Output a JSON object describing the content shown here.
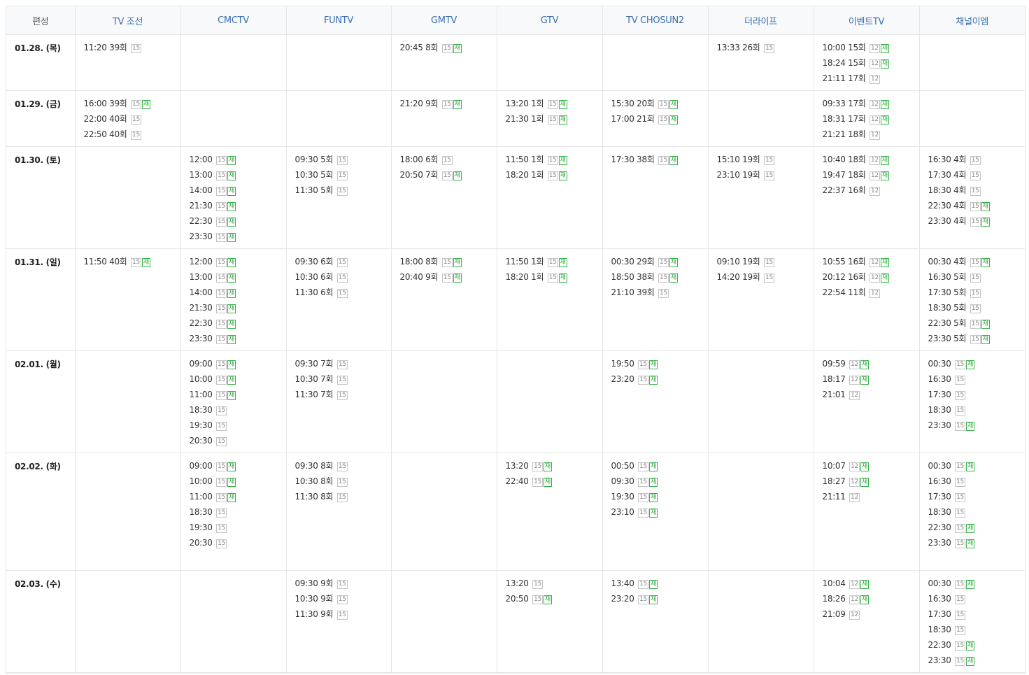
{
  "header": [
    "편성",
    "TV 조선",
    "CMCTV",
    "FUNTV",
    "GMTV",
    "GTV",
    "TV CHOSUN2",
    "더라이프",
    "이벤트TV",
    "채널이엠"
  ],
  "rows": [
    {
      "date": "01.28. (목)",
      "h": 80,
      "cells": [
        [
          {
            "t": "11:20",
            "e": "39회",
            "a": "15"
          }
        ],
        [],
        [],
        [
          {
            "t": "20:45",
            "e": "8회",
            "a": "15",
            "r": "재"
          }
        ],
        [],
        [],
        [
          {
            "t": "13:33",
            "e": "26회",
            "a": "15"
          }
        ],
        [
          {
            "t": "10:00",
            "e": "15회",
            "a": "12",
            "r": "재"
          },
          {
            "t": "18:24",
            "e": "15회",
            "a": "12",
            "r": "재"
          },
          {
            "t": "21:11",
            "e": "17회",
            "a": "12"
          }
        ],
        []
      ]
    },
    {
      "date": "01.29. (금)",
      "h": 80,
      "cells": [
        [
          {
            "t": "16:00",
            "e": "39회",
            "a": "15",
            "r": "재"
          },
          {
            "t": "22:00",
            "e": "40회",
            "a": "15"
          },
          {
            "t": "22:50",
            "e": "40회",
            "a": "15"
          }
        ],
        [],
        [],
        [
          {
            "t": "21:20",
            "e": "9회",
            "a": "15",
            "r": "재"
          }
        ],
        [
          {
            "t": "13:20",
            "e": "1회",
            "a": "15",
            "r": "재"
          },
          {
            "t": "21:30",
            "e": "1회",
            "a": "15",
            "r": "재"
          }
        ],
        [
          {
            "t": "15:30",
            "e": "20회",
            "a": "15",
            "r": "재"
          },
          {
            "t": "17:00",
            "e": "21회",
            "a": "15",
            "r": "재"
          }
        ],
        [],
        [
          {
            "t": "09:33",
            "e": "17회",
            "a": "12",
            "r": "재"
          },
          {
            "t": "18:31",
            "e": "17회",
            "a": "12",
            "r": "재"
          },
          {
            "t": "21:21",
            "e": "18회",
            "a": "12"
          }
        ],
        []
      ]
    },
    {
      "date": "01.30. (토)",
      "h": 146,
      "cells": [
        [],
        [
          {
            "t": "12:00",
            "a": "15",
            "r": "재"
          },
          {
            "t": "13:00",
            "a": "15",
            "r": "재"
          },
          {
            "t": "14:00",
            "a": "15",
            "r": "재"
          },
          {
            "t": "21:30",
            "a": "15",
            "r": "재"
          },
          {
            "t": "22:30",
            "a": "15",
            "r": "재"
          },
          {
            "t": "23:30",
            "a": "15",
            "r": "재"
          }
        ],
        [
          {
            "t": "09:30",
            "e": "5회",
            "a": "15"
          },
          {
            "t": "10:30",
            "e": "5회",
            "a": "15"
          },
          {
            "t": "11:30",
            "e": "5회",
            "a": "15"
          }
        ],
        [
          {
            "t": "18:00",
            "e": "6회",
            "a": "15"
          },
          {
            "t": "20:50",
            "e": "7회",
            "a": "15",
            "r": "재"
          }
        ],
        [
          {
            "t": "11:50",
            "e": "1회",
            "a": "15",
            "r": "재"
          },
          {
            "t": "18:20",
            "e": "1회",
            "a": "15",
            "r": "재"
          }
        ],
        [
          {
            "t": "17:30",
            "e": "38회",
            "a": "15",
            "r": "재"
          }
        ],
        [
          {
            "t": "15:10",
            "e": "19회",
            "a": "15"
          },
          {
            "t": "23:10",
            "e": "19회",
            "a": "15"
          }
        ],
        [
          {
            "t": "10:40",
            "e": "18회",
            "a": "12",
            "r": "재"
          },
          {
            "t": "19:47",
            "e": "18회",
            "a": "12",
            "r": "재"
          },
          {
            "t": "22:37",
            "e": "16회",
            "a": "12"
          }
        ],
        [
          {
            "t": "16:30",
            "e": "4회",
            "a": "15"
          },
          {
            "t": "17:30",
            "e": "4회",
            "a": "15"
          },
          {
            "t": "18:30",
            "e": "4회",
            "a": "15"
          },
          {
            "t": "22:30",
            "e": "4회",
            "a": "15",
            "r": "재"
          },
          {
            "t": "23:30",
            "e": "4회",
            "a": "15",
            "r": "재"
          }
        ]
      ]
    },
    {
      "date": "01.31. (일)",
      "h": 146,
      "cells": [
        [
          {
            "t": "11:50",
            "e": "40회",
            "a": "15",
            "r": "재"
          }
        ],
        [
          {
            "t": "12:00",
            "a": "15",
            "r": "재"
          },
          {
            "t": "13:00",
            "a": "15",
            "r": "재"
          },
          {
            "t": "14:00",
            "a": "15",
            "r": "재"
          },
          {
            "t": "21:30",
            "a": "15",
            "r": "재"
          },
          {
            "t": "22:30",
            "a": "15",
            "r": "재"
          },
          {
            "t": "23:30",
            "a": "15",
            "r": "재"
          }
        ],
        [
          {
            "t": "09:30",
            "e": "6회",
            "a": "15"
          },
          {
            "t": "10:30",
            "e": "6회",
            "a": "15"
          },
          {
            "t": "11:30",
            "e": "6회",
            "a": "15"
          }
        ],
        [
          {
            "t": "18:00",
            "e": "8회",
            "a": "15",
            "r": "재"
          },
          {
            "t": "20:40",
            "e": "9회",
            "a": "15",
            "r": "재"
          }
        ],
        [
          {
            "t": "11:50",
            "e": "1회",
            "a": "15",
            "r": "재"
          },
          {
            "t": "18:20",
            "e": "1회",
            "a": "15",
            "r": "재"
          }
        ],
        [
          {
            "t": "00:30",
            "e": "29회",
            "a": "15",
            "r": "재"
          },
          {
            "t": "18:50",
            "e": "38회",
            "a": "15",
            "r": "재"
          },
          {
            "t": "21:10",
            "e": "39회",
            "a": "15"
          }
        ],
        [
          {
            "t": "09:10",
            "e": "19회",
            "a": "15"
          },
          {
            "t": "14:20",
            "e": "19회",
            "a": "15"
          }
        ],
        [
          {
            "t": "10:55",
            "e": "16회",
            "a": "12",
            "r": "재"
          },
          {
            "t": "20:12",
            "e": "16회",
            "a": "12",
            "r": "재"
          },
          {
            "t": "22:54",
            "e": "11회",
            "a": "12"
          }
        ],
        [
          {
            "t": "00:30",
            "e": "4회",
            "a": "15",
            "r": "재"
          },
          {
            "t": "16:30",
            "e": "5회",
            "a": "15"
          },
          {
            "t": "17:30",
            "e": "5회",
            "a": "15"
          },
          {
            "t": "18:30",
            "e": "5회",
            "a": "15"
          },
          {
            "t": "22:30",
            "e": "5회",
            "a": "15",
            "r": "재"
          },
          {
            "t": "23:30",
            "e": "5회",
            "a": "15",
            "r": "재"
          }
        ]
      ]
    },
    {
      "date": "02.01. (월)",
      "h": 146,
      "cells": [
        [],
        [
          {
            "t": "09:00",
            "a": "15",
            "r": "재"
          },
          {
            "t": "10:00",
            "a": "15",
            "r": "재"
          },
          {
            "t": "11:00",
            "a": "15",
            "r": "재"
          },
          {
            "t": "18:30",
            "a": "15"
          },
          {
            "t": "19:30",
            "a": "15"
          },
          {
            "t": "20:30",
            "a": "15"
          }
        ],
        [
          {
            "t": "09:30",
            "e": "7회",
            "a": "15"
          },
          {
            "t": "10:30",
            "e": "7회",
            "a": "15"
          },
          {
            "t": "11:30",
            "e": "7회",
            "a": "15"
          }
        ],
        [],
        [],
        [
          {
            "t": "19:50",
            "a": "15",
            "r": "재"
          },
          {
            "t": "23:20",
            "a": "15",
            "r": "재"
          }
        ],
        [],
        [
          {
            "t": "09:59",
            "a": "12",
            "r": "재"
          },
          {
            "t": "18:17",
            "a": "12",
            "r": "재"
          },
          {
            "t": "21:01",
            "a": "12"
          }
        ],
        [
          {
            "t": "00:30",
            "a": "15",
            "r": "재"
          },
          {
            "t": "16:30",
            "a": "15"
          },
          {
            "t": "17:30",
            "a": "15"
          },
          {
            "t": "18:30",
            "a": "15"
          },
          {
            "t": "23:30",
            "a": "15",
            "r": "재"
          }
        ]
      ]
    },
    {
      "date": "02.02. (화)",
      "h": 168,
      "cells": [
        [],
        [
          {
            "t": "09:00",
            "a": "15",
            "r": "재"
          },
          {
            "t": "10:00",
            "a": "15",
            "r": "재"
          },
          {
            "t": "11:00",
            "a": "15",
            "r": "재"
          },
          {
            "t": "18:30",
            "a": "15"
          },
          {
            "t": "19:30",
            "a": "15"
          },
          {
            "t": "20:30",
            "a": "15"
          }
        ],
        [
          {
            "t": "09:30",
            "e": "8회",
            "a": "15"
          },
          {
            "t": "10:30",
            "e": "8회",
            "a": "15"
          },
          {
            "t": "11:30",
            "e": "8회",
            "a": "15"
          }
        ],
        [],
        [
          {
            "t": "13:20",
            "a": "15",
            "r": "재"
          },
          {
            "t": "22:40",
            "a": "15",
            "r": "재"
          }
        ],
        [
          {
            "t": "00:50",
            "a": "15",
            "r": "재"
          },
          {
            "t": "09:30",
            "a": "15",
            "r": "재"
          },
          {
            "t": "19:30",
            "a": "15",
            "r": "재"
          },
          {
            "t": "23:10",
            "a": "15",
            "r": "재"
          }
        ],
        [],
        [
          {
            "t": "10:07",
            "a": "12",
            "r": "재"
          },
          {
            "t": "18:27",
            "a": "12",
            "r": "재"
          },
          {
            "t": "21:11",
            "a": "12"
          }
        ],
        [
          {
            "t": "00:30",
            "a": "15",
            "r": "재"
          },
          {
            "t": "16:30",
            "a": "15"
          },
          {
            "t": "17:30",
            "a": "15"
          },
          {
            "t": "18:30",
            "a": "15"
          },
          {
            "t": "22:30",
            "a": "15",
            "r": "재"
          },
          {
            "t": "23:30",
            "a": "15",
            "r": "재"
          }
        ]
      ]
    },
    {
      "date": "02.03. (수)",
      "h": 146,
      "cells": [
        [],
        [],
        [
          {
            "t": "09:30",
            "e": "9회",
            "a": "15"
          },
          {
            "t": "10:30",
            "e": "9회",
            "a": "15"
          },
          {
            "t": "11:30",
            "e": "9회",
            "a": "15"
          }
        ],
        [],
        [
          {
            "t": "13:20",
            "a": "15"
          },
          {
            "t": "20:50",
            "a": "15",
            "r": "재"
          }
        ],
        [
          {
            "t": "13:40",
            "a": "15",
            "r": "재"
          },
          {
            "t": "23:20",
            "a": "15",
            "r": "재"
          }
        ],
        [],
        [
          {
            "t": "10:04",
            "a": "12",
            "r": "재"
          },
          {
            "t": "18:26",
            "a": "12",
            "r": "재"
          },
          {
            "t": "21:09",
            "a": "12"
          }
        ],
        [
          {
            "t": "00:30",
            "a": "15",
            "r": "재"
          },
          {
            "t": "16:30",
            "a": "15"
          },
          {
            "t": "17:30",
            "a": "15"
          },
          {
            "t": "18:30",
            "a": "15"
          },
          {
            "t": "22:30",
            "a": "15",
            "r": "재"
          },
          {
            "t": "23:30",
            "a": "15",
            "r": "재"
          }
        ]
      ]
    }
  ]
}
